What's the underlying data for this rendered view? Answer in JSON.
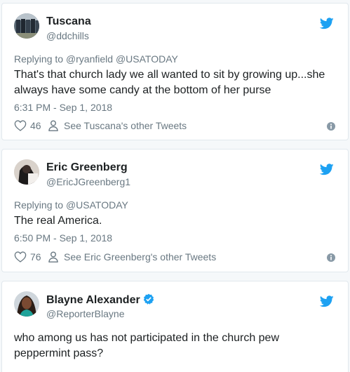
{
  "colors": {
    "twitter_blue": "#1da1f2",
    "muted": "#697882",
    "text": "#1c2022"
  },
  "icons": {
    "bird": "twitter-bird-icon",
    "heart": "heart-icon",
    "person": "person-icon",
    "info": "info-icon",
    "verified": "verified-badge-icon"
  },
  "tweets": [
    {
      "name": "Tuscana",
      "handle": "@ddchills",
      "reply_prefix": "Replying to ",
      "reply_mentions": "@ryanfield @USATODAY",
      "text": "That's that church lady we all wanted to sit by growing up...she always have some candy at the bottom of her purse",
      "timestamp": "6:31 PM - Sep 1, 2018",
      "likes": "46",
      "other_tweets": "See Tuscana's other Tweets"
    },
    {
      "name": "Eric Greenberg",
      "handle": "@EricJGreenberg1",
      "reply_prefix": "Replying to ",
      "reply_mentions": "@USATODAY",
      "text": "The real America.",
      "timestamp": "6:50 PM - Sep 1, 2018",
      "likes": "76",
      "other_tweets": "See Eric Greenberg's other Tweets"
    },
    {
      "name": "Blayne Alexander",
      "handle": "@ReporterBlayne",
      "verified": true,
      "text": "who among us has not participated in the church pew peppermint pass?"
    }
  ]
}
